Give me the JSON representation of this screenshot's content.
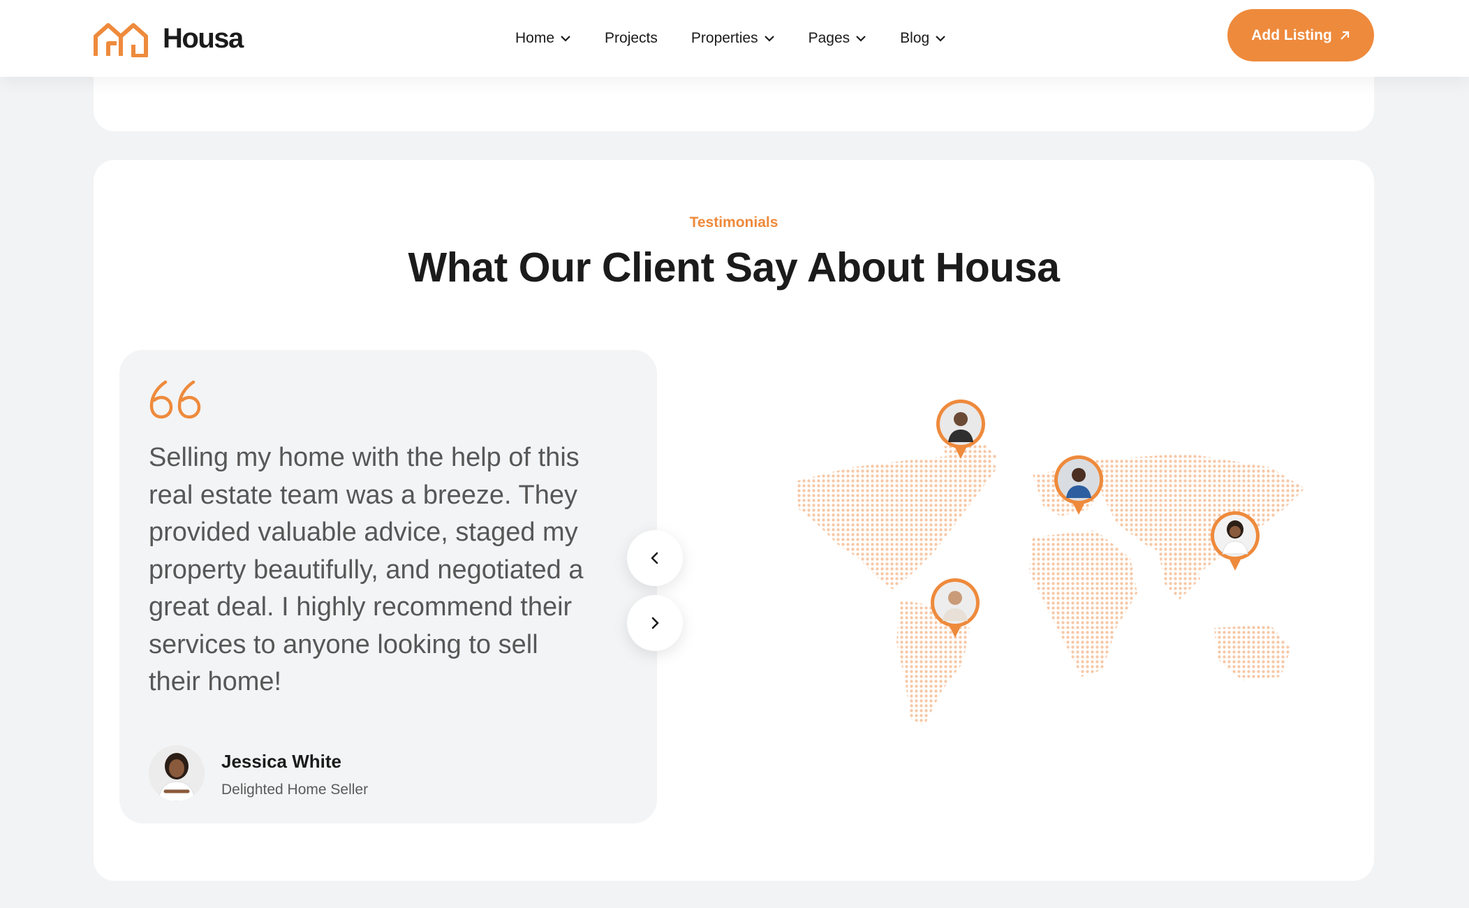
{
  "brand": {
    "name": "Housa",
    "accent": "#ee8a3c"
  },
  "nav": {
    "items": [
      {
        "label": "Home",
        "has_dropdown": true
      },
      {
        "label": "Projects",
        "has_dropdown": false
      },
      {
        "label": "Properties",
        "has_dropdown": true
      },
      {
        "label": "Pages",
        "has_dropdown": true
      },
      {
        "label": "Blog",
        "has_dropdown": true
      }
    ],
    "cta_label": "Add Listing"
  },
  "testimonials": {
    "eyebrow": "Testimonials",
    "title": "What Our Client Say About Housa",
    "quote": "Selling my home with the help of this real estate team was a breeze. They provided valuable advice, staged my property beautifully, and negotiated a great deal. I highly recommend their services to anyone looking to sell their home!",
    "author_name": "Jessica White",
    "author_role": "Delighted Home Seller",
    "icons": [
      "quote-icon",
      "chevron-left-icon",
      "chevron-right-icon",
      "world-map",
      "location-pin-icon"
    ]
  }
}
